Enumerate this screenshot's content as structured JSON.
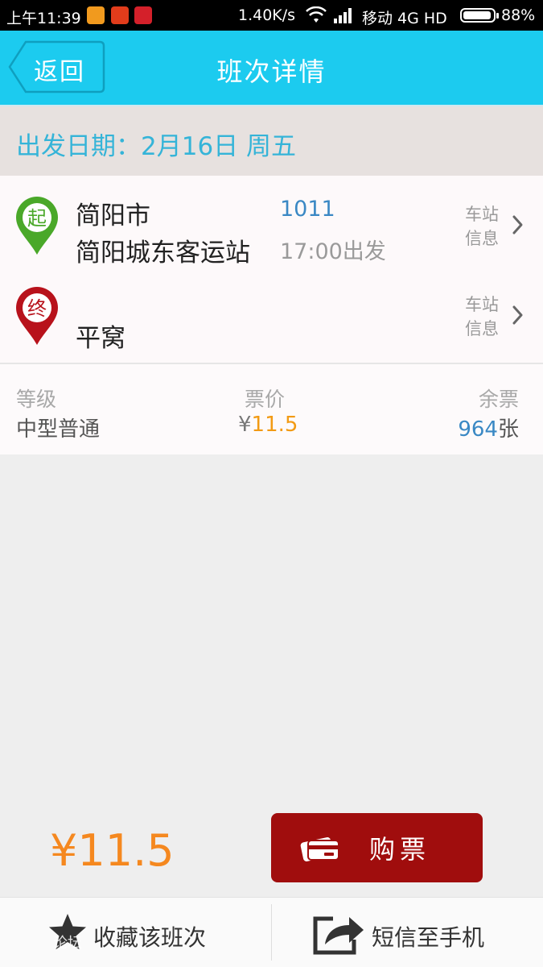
{
  "status_bar": {
    "time": "上午11:39",
    "net_speed": "1.40K/s",
    "carrier": "移动 4G HD",
    "battery": "88%"
  },
  "header": {
    "back_label": "返回",
    "title": "班次详情"
  },
  "date_bar": {
    "text": "出发日期：2月16日 周五"
  },
  "route": {
    "start_marker": "起",
    "start_city": "简阳市",
    "start_station": "简阳城东客运站",
    "bus_number": "1011",
    "departure": "17:00出发",
    "end_marker": "终",
    "end_city": "平窝",
    "station_info_line1": "车站",
    "station_info_line2": "信息"
  },
  "ticket_info": {
    "grade_label": "等级",
    "grade_value": "中型普通",
    "price_label": "票价",
    "price_currency": "¥",
    "price_value": "11.5",
    "remain_label": "余票",
    "remain_value": "964",
    "remain_unit": "张"
  },
  "purchase": {
    "total": "¥11.5",
    "buy_label": "购票"
  },
  "footer": {
    "favorite_label": "收藏该班次",
    "sms_label": "短信至手机",
    "watermark": "论坛"
  },
  "colors": {
    "header": "#1ccbef",
    "date_text": "#35b4d8",
    "buy_button": "#a00d0d",
    "price": "#f29a13",
    "total_price": "#f5881f",
    "link_blue": "#3a88c4",
    "start_pin": "#4aa829",
    "end_pin": "#b8121b"
  }
}
